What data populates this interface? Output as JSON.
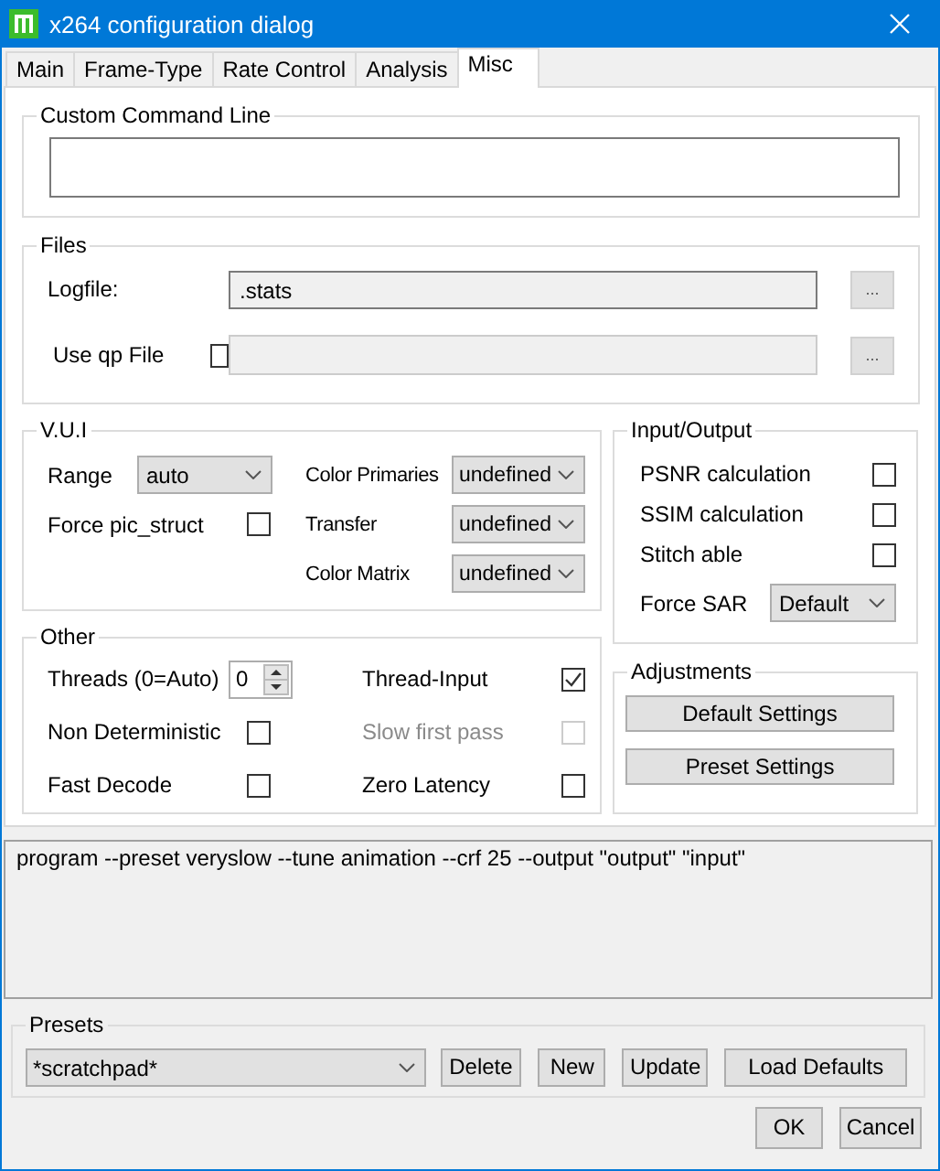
{
  "window": {
    "title": "x264 configuration dialog"
  },
  "tabs": [
    {
      "label": "Main",
      "selected": false
    },
    {
      "label": "Frame-Type",
      "selected": false
    },
    {
      "label": "Rate Control",
      "selected": false
    },
    {
      "label": "Analysis",
      "selected": false
    },
    {
      "label": "Misc",
      "selected": true
    }
  ],
  "custom_command_line": {
    "title": "Custom Command Line"
  },
  "files": {
    "title": "Files",
    "rows": [
      {
        "kind": "text",
        "label": "Logfile:",
        "value": ".stats",
        "browse": "..."
      },
      {
        "kind": "checkbox",
        "label": "Use qp File",
        "checked": false,
        "browse": "..."
      }
    ]
  },
  "vui": {
    "title": "V.U.I",
    "columns": [
      [
        {
          "kind": "select",
          "label": "Range",
          "value": "auto"
        },
        {
          "kind": "checkbox",
          "label": "Force pic_struct",
          "checked": false
        }
      ],
      [
        {
          "kind": "select",
          "label": "Color Primaries",
          "value": "undefined"
        },
        {
          "kind": "select",
          "label": "Transfer",
          "value": "undefined"
        },
        {
          "kind": "select",
          "label": "Color Matrix",
          "value": "undefined"
        }
      ]
    ]
  },
  "input_output": {
    "title": "Input/Output",
    "items": [
      {
        "kind": "checkbox",
        "label": "PSNR calculation",
        "checked": false
      },
      {
        "kind": "checkbox",
        "label": "SSIM calculation",
        "checked": false
      },
      {
        "kind": "checkbox",
        "label": "Stitch able",
        "checked": false
      },
      {
        "kind": "select",
        "label": "Force SAR",
        "value": "Default"
      }
    ]
  },
  "other": {
    "title": "Other",
    "columns": [
      [
        {
          "kind": "spin",
          "label": "Threads (0=Auto)",
          "value": "0"
        },
        {
          "kind": "checkbox",
          "label": "Non Deterministic",
          "checked": false,
          "disabled": false
        },
        {
          "kind": "checkbox",
          "label": "Fast Decode",
          "checked": false,
          "disabled": false
        }
      ],
      [
        {
          "kind": "checkbox",
          "label": "Thread-Input",
          "checked": true,
          "disabled": false
        },
        {
          "kind": "checkbox",
          "label": "Slow first pass",
          "checked": false,
          "disabled": true
        },
        {
          "kind": "checkbox",
          "label": "Zero Latency",
          "checked": false,
          "disabled": false
        }
      ]
    ]
  },
  "adjustments": {
    "title": "Adjustments",
    "buttons": [
      "Default Settings",
      "Preset Settings"
    ]
  },
  "command_preview": "program --preset veryslow --tune animation --crf 25 --output \"output\" \"input\"",
  "presets": {
    "title": "Presets",
    "selection": "*scratchpad*",
    "buttons": [
      "Delete",
      "New",
      "Update",
      "Load Defaults"
    ]
  },
  "buttons": [
    "OK",
    "Cancel"
  ]
}
